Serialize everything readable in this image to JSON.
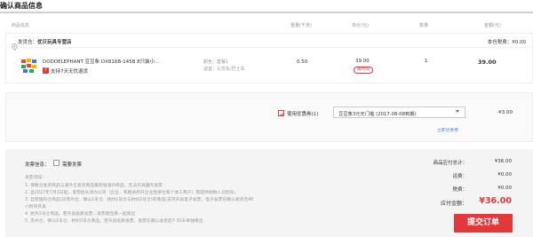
{
  "page": {
    "title": "确认商品信息"
  },
  "columns": {
    "product": "商品信息",
    "weight": "重量(千克)",
    "unit_price": "单价(元)",
    "quantity": "数量",
    "amount": "金额(元)"
  },
  "shipping": {
    "prefix": "发货仓：",
    "store": "优贝玩具专营店",
    "tax_note": "本仓税费：¥0.00"
  },
  "item": {
    "name": "DODOELEPHANT 豆豆象 DX816B-145B 8只装小...",
    "return_policy": "支持7天无忧退货",
    "return_badge": "7",
    "color": "颜色：套餐1",
    "type": "适宜：公交车/巴士车",
    "weight": "0.50",
    "price": "39.00",
    "limit_badge": "限时购",
    "quantity": "1",
    "amount": "39.00"
  },
  "coupon": {
    "label": "使用优惠券(1)",
    "selected": "豆豆象3元无门槛 (2017-08-08到期)",
    "discount": "-¥3.00",
    "link": "立即优惠券"
  },
  "invoice": {
    "label": "发票信息：",
    "option": "需要发票"
  },
  "notes": [
    "发票须知：",
    "1. 保税仓发货商品与海外仓发货商品属跨境海外商品，无法开具国内发票",
    "2. 自2017年7月1日起，发票抬头须为公司（企业、有相关所开企业性单位和个体工商户）需提供纳税人识别号。",
    "3. 自营国内仓商品(双苏州仓、佛山1号仓、杭州1号仓与杭州2号仓)的商品(支持开具电子发票，电子发票在确认收货后48",
    "小时内开具",
    "4. 杭州1号仓商品，若开具纸质发票，发票随包裹一起寄出",
    "5. 苏州仓、佛山1号仓、杭州2号仓商品，若开具纸质发票，发票在确认收货后7-30天单独寄出"
  ],
  "summary": {
    "total_label": "商品应付总计：",
    "total_value": "¥36.00",
    "shipping_label": "运费：",
    "shipping_value": "¥0.00",
    "tax_label": "税费：",
    "tax_value": "¥0.00",
    "pay_label": "应付金额：",
    "pay_value": "¥36.00"
  },
  "submit_label": "提交订单",
  "colors": {
    "accent": "#e4393c",
    "link": "#5b8ad6"
  }
}
